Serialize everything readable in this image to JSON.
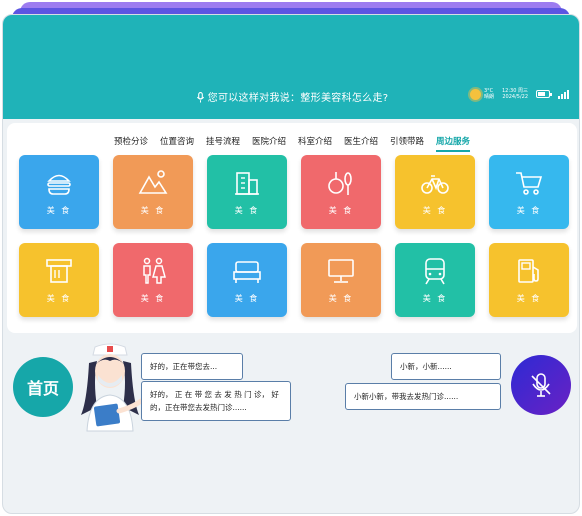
{
  "header": {
    "voice_prompt": "您可以这样对我说：整形美容科怎么走?",
    "weather_line1": "3°C",
    "weather_line2": "晴朗",
    "time_line": "12:30 周三",
    "date_line": "2024/5/22",
    "battery_level": 0.7
  },
  "tabs": [
    {
      "label": "预检分诊",
      "active": false
    },
    {
      "label": "位置咨询",
      "active": false
    },
    {
      "label": "挂号流程",
      "active": false
    },
    {
      "label": "医院介绍",
      "active": false
    },
    {
      "label": "科室介绍",
      "active": false
    },
    {
      "label": "医生介绍",
      "active": false
    },
    {
      "label": "引领带路",
      "active": false
    },
    {
      "label": "周边服务",
      "active": true
    }
  ],
  "tiles": [
    {
      "label": "美 食",
      "icon": "burger-icon",
      "color": "#3aa6ec"
    },
    {
      "label": "美 食",
      "icon": "landscape-icon",
      "color": "#f19a57"
    },
    {
      "label": "美 食",
      "icon": "building-icon",
      "color": "#22c0a6"
    },
    {
      "label": "美 食",
      "icon": "dining-icon",
      "color": "#f0696c"
    },
    {
      "label": "美 食",
      "icon": "bicycle-icon",
      "color": "#f6c22d"
    },
    {
      "label": "美 食",
      "icon": "shopping-cart-icon",
      "color": "#36b8ee"
    },
    {
      "label": "美 食",
      "icon": "atm-icon",
      "color": "#f6c22d"
    },
    {
      "label": "美 食",
      "icon": "restroom-icon",
      "color": "#f0696c"
    },
    {
      "label": "美 食",
      "icon": "hotel-bed-icon",
      "color": "#3aa6ec"
    },
    {
      "label": "美 食",
      "icon": "computer-icon",
      "color": "#f19a57"
    },
    {
      "label": "美 食",
      "icon": "train-icon",
      "color": "#22c0a6"
    },
    {
      "label": "美 食",
      "icon": "gas-station-icon",
      "color": "#f6c22d"
    }
  ],
  "home_label": "首页",
  "chat": {
    "robot_1": "好的，正在带您去...",
    "robot_2_line1": "好的， 正 在 带 您 去 发 热 门 诊， 好",
    "robot_2_line2": "的，正在带您去发热门诊......",
    "user_1": "小新，小新......",
    "user_2": "小新小新，带我去发热门诊......"
  },
  "colors": {
    "header": "#1fb3b8",
    "accent": "#16a7a9",
    "mic_gradient_start": "#2d2ad4",
    "mic_gradient_end": "#6a21c4"
  }
}
